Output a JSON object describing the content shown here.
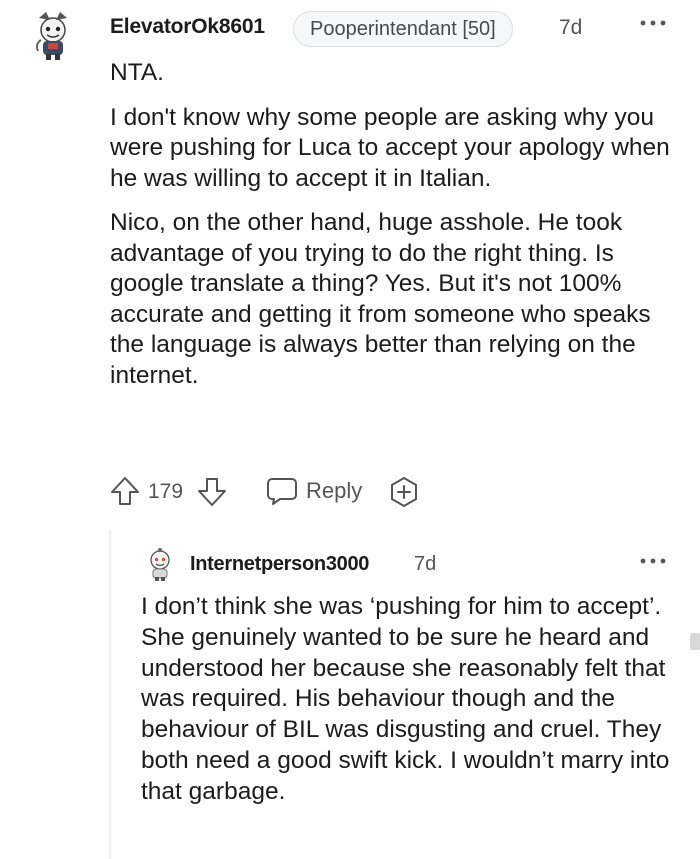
{
  "comment": {
    "username": "ElevatorOk8601",
    "flair": "Pooperintendant [50]",
    "time": "7d",
    "paragraphs": [
      "NTA.",
      "I don't know why some people are asking why you were pushing for Luca to accept your apology when he was willing to accept it in Italian.",
      "Nico, on the other hand, huge asshole. He took advantage of you trying to do the right thing. Is google translate a thing? Yes. But it's not 100% accurate and getting it from someone who speaks the language is always better than relying on the internet."
    ],
    "vote_count": "179",
    "reply_label": "Reply"
  },
  "reply": {
    "username": "Internetperson3000",
    "time": "7d",
    "paragraphs": [
      "I don’t think she was ‘pushing for him to accept’. She genuinely wanted to be sure he heard and understood her because she reasonably felt that was required. His behaviour though and the behaviour of BIL was disgusting and cruel. They both need a good swift kick. I wouldn’t marry into that garbage."
    ]
  },
  "icons": {
    "avatar": "snoo-avatar-icon",
    "upvote": "arrow-up-icon",
    "downvote": "arrow-down-icon",
    "reply": "speech-bubble-icon",
    "award": "add-award-icon",
    "more": "more-dots-icon"
  },
  "colors": {
    "text": "#1c1c1c",
    "meta": "#555555",
    "flair_bg": "#f6f7f8"
  }
}
